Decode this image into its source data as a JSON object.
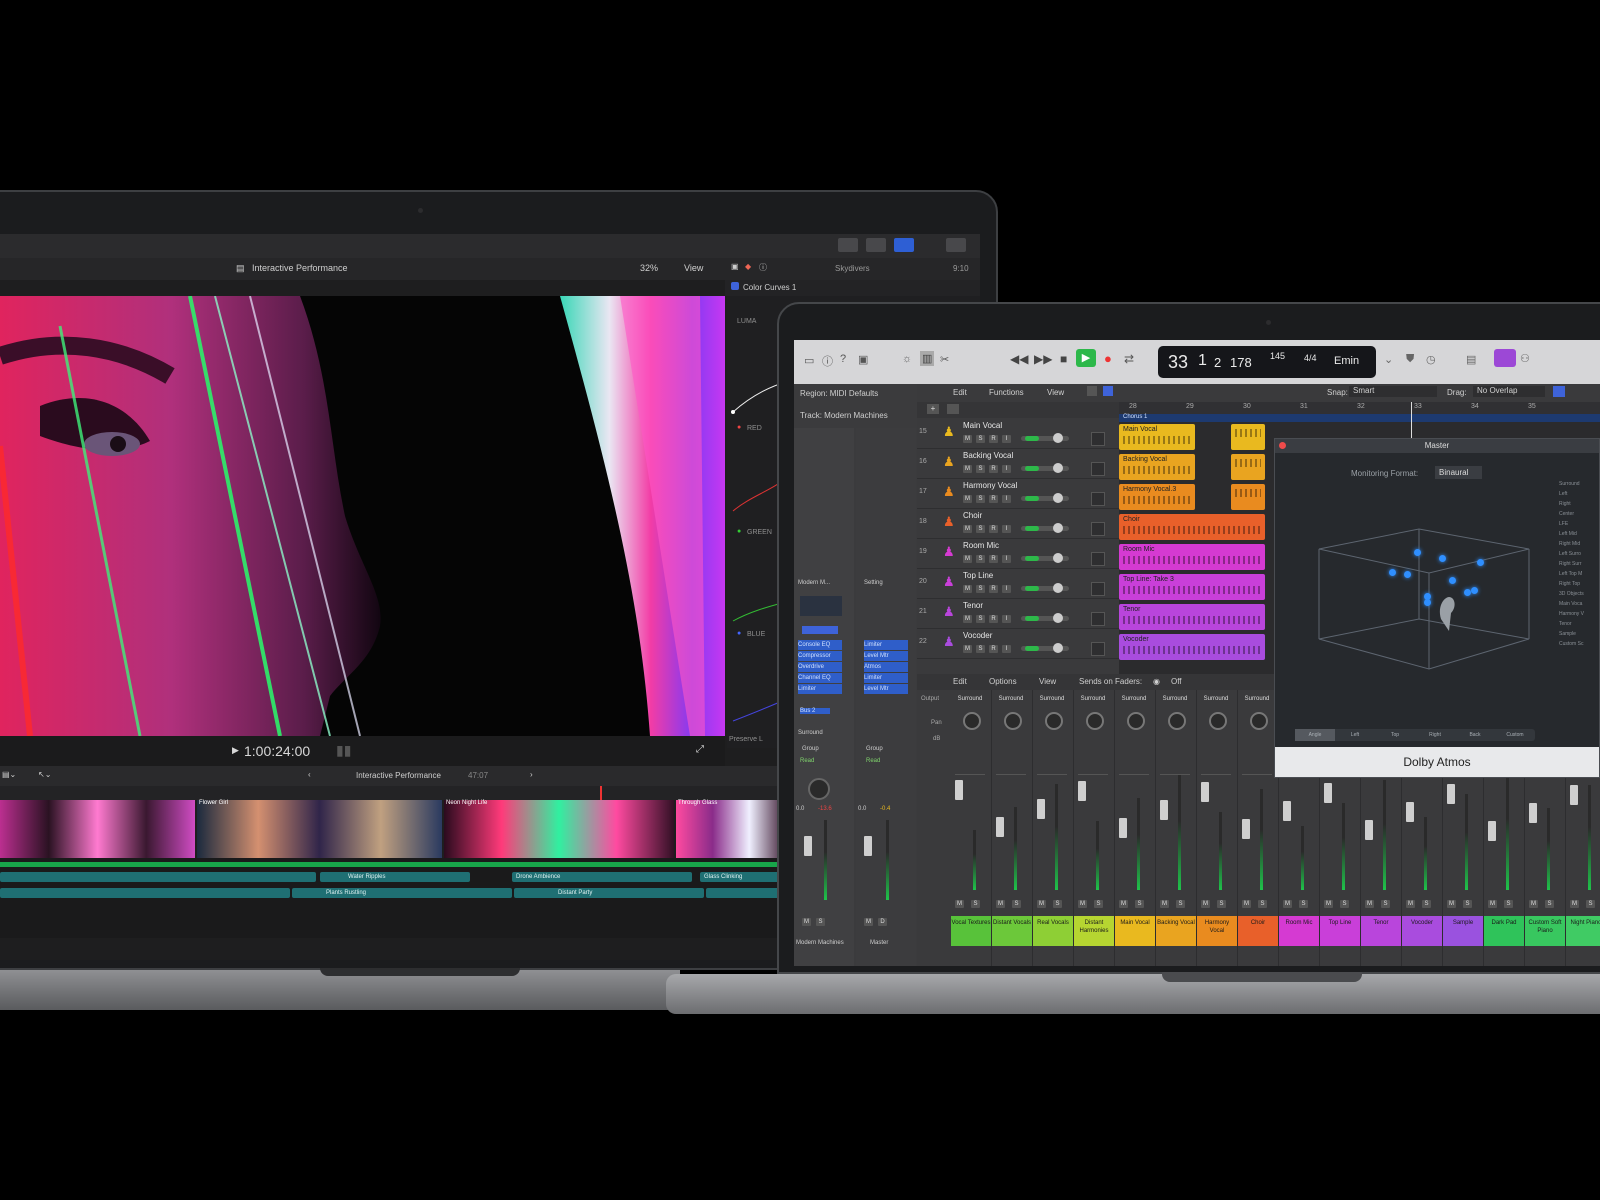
{
  "fcp": {
    "project_title": "Interactive Performance",
    "zoom": "32%",
    "view_menu": "View",
    "inspector_clip": "Skydivers",
    "inspector_time": "9:10",
    "effect": "Color Curves 1",
    "channels": [
      "LUMA",
      "RED",
      "GREEN",
      "BLUE"
    ],
    "preserve_label": "Preserve L",
    "timecode": "1:00:24:00",
    "timeline_title": "Interactive Performance",
    "timeline_duration": "47:07",
    "clip_labels": [
      "Flower Girl",
      "Neon Night Life",
      "Through Glass"
    ],
    "audio_clips": [
      "Water Ripples",
      "Drone Ambience",
      "Glass Clinking",
      "Plants Rustling",
      "Distant Party"
    ]
  },
  "logic": {
    "lcd": {
      "bar": "33",
      "beat": "1",
      "div": "2",
      "tick": "178",
      "tempo": "145",
      "sig": "4/4",
      "key": "Emin"
    },
    "region": "Region: MIDI Defaults",
    "track": "Track: Modern Machines",
    "edit_menu": "Edit",
    "functions_menu": "Functions",
    "view_menu": "View",
    "snap_label": "Snap:",
    "snap_value": "Smart",
    "drag_label": "Drag:",
    "drag_value": "No Overlap",
    "ruler": [
      "28",
      "29",
      "30",
      "31",
      "32",
      "33",
      "34",
      "35"
    ],
    "marker": "Chorus 1",
    "tracks": [
      {
        "num": "15",
        "name": "Main Vocal",
        "color": "#e9b91f"
      },
      {
        "num": "16",
        "name": "Backing Vocal",
        "color": "#e9a420"
      },
      {
        "num": "17",
        "name": "Harmony Vocal",
        "color": "#e98b1f"
      },
      {
        "num": "18",
        "name": "Choir",
        "color": "#e8602a"
      },
      {
        "num": "19",
        "name": "Room Mic",
        "color": "#d53ad2"
      },
      {
        "num": "20",
        "name": "Top Line",
        "color": "#c93fd9"
      },
      {
        "num": "21",
        "name": "Tenor",
        "color": "#b945dc"
      },
      {
        "num": "22",
        "name": "Vocoder",
        "color": "#a94cde"
      }
    ],
    "regions": [
      {
        "label": "Main Vocal",
        "color": "#e9b91f"
      },
      {
        "label": "Backing Vocal",
        "color": "#e9a420"
      },
      {
        "label": "Harmony Vocal.3",
        "color": "#e98b1f"
      },
      {
        "label": "Choir",
        "color": "#e8602a"
      },
      {
        "label": "Room Mic",
        "color": "#d53ad2"
      },
      {
        "label": "Top Line: Take 3",
        "color": "#c93fd9"
      },
      {
        "label": "Tenor",
        "color": "#b945dc"
      },
      {
        "label": "Vocoder",
        "color": "#a94cde"
      }
    ],
    "inspector_strip": {
      "name": "Modern M...",
      "setting": "Setting",
      "plugins": [
        "Console EQ",
        "Compressor",
        "Overdrive",
        "Channel EQ",
        "Limiter"
      ],
      "plugins2": [
        "Limiter",
        "Level Mtr",
        "Atmos",
        "Limiter",
        "Level Mtr"
      ],
      "send": "Bus 2",
      "output": "Surround",
      "group": "Group",
      "read": "Read",
      "foot": [
        "Modern Machines",
        "Master"
      ],
      "values": [
        "0.0",
        "-13.6",
        "0.0",
        "-0.4"
      ]
    },
    "mixer_menu": {
      "edit": "Edit",
      "options": "Options",
      "view": "View",
      "sends": "Sends on Faders:",
      "sends_value": "Off"
    },
    "mixer_labels": {
      "output": "Output",
      "pan": "Pan",
      "db": "dB"
    },
    "mixer_output": "Surround",
    "channels": [
      {
        "name": "Vocal Textures",
        "color": "#58c23a"
      },
      {
        "name": "Distant Vocals",
        "color": "#6cc83a"
      },
      {
        "name": "Real Vocals",
        "color": "#8ecf35"
      },
      {
        "name": "Distant Harmonies",
        "color": "#b6d531"
      },
      {
        "name": "Main Vocal",
        "color": "#e9b91f"
      },
      {
        "name": "Backing Vocal",
        "color": "#e9a420"
      },
      {
        "name": "Harmony Vocal",
        "color": "#e98b1f"
      },
      {
        "name": "Choir",
        "color": "#e8602a"
      },
      {
        "name": "Room Mic",
        "color": "#d53ad2"
      },
      {
        "name": "Top Line",
        "color": "#c93fd9"
      },
      {
        "name": "Tenor",
        "color": "#b945dc"
      },
      {
        "name": "Vocoder",
        "color": "#a94cde"
      },
      {
        "name": "Sample",
        "color": "#9a52df"
      },
      {
        "name": "Dark Pad",
        "color": "#2fc35a"
      },
      {
        "name": "Custom Soft Piano",
        "color": "#38c75f"
      },
      {
        "name": "Night Piano",
        "color": "#40cb64"
      }
    ],
    "atmos": {
      "title": "Master",
      "monitoring_label": "Monitoring Format:",
      "monitoring_value": "Binaural",
      "footer": "Dolby Atmos",
      "view_tabs": [
        "Angle",
        "Left",
        "Top",
        "Right",
        "Back",
        "Custom"
      ],
      "side_list": [
        "Surround",
        "Left",
        "Right",
        "Center",
        "LFE",
        "Left Mid",
        "Right Mid",
        "Left Surro",
        "Right Surr",
        "Left Top M",
        "Right Top",
        "3D Objects",
        "Main Voca",
        "Harmony V",
        "Tenor",
        "Sample",
        "Custom Sc"
      ]
    }
  }
}
